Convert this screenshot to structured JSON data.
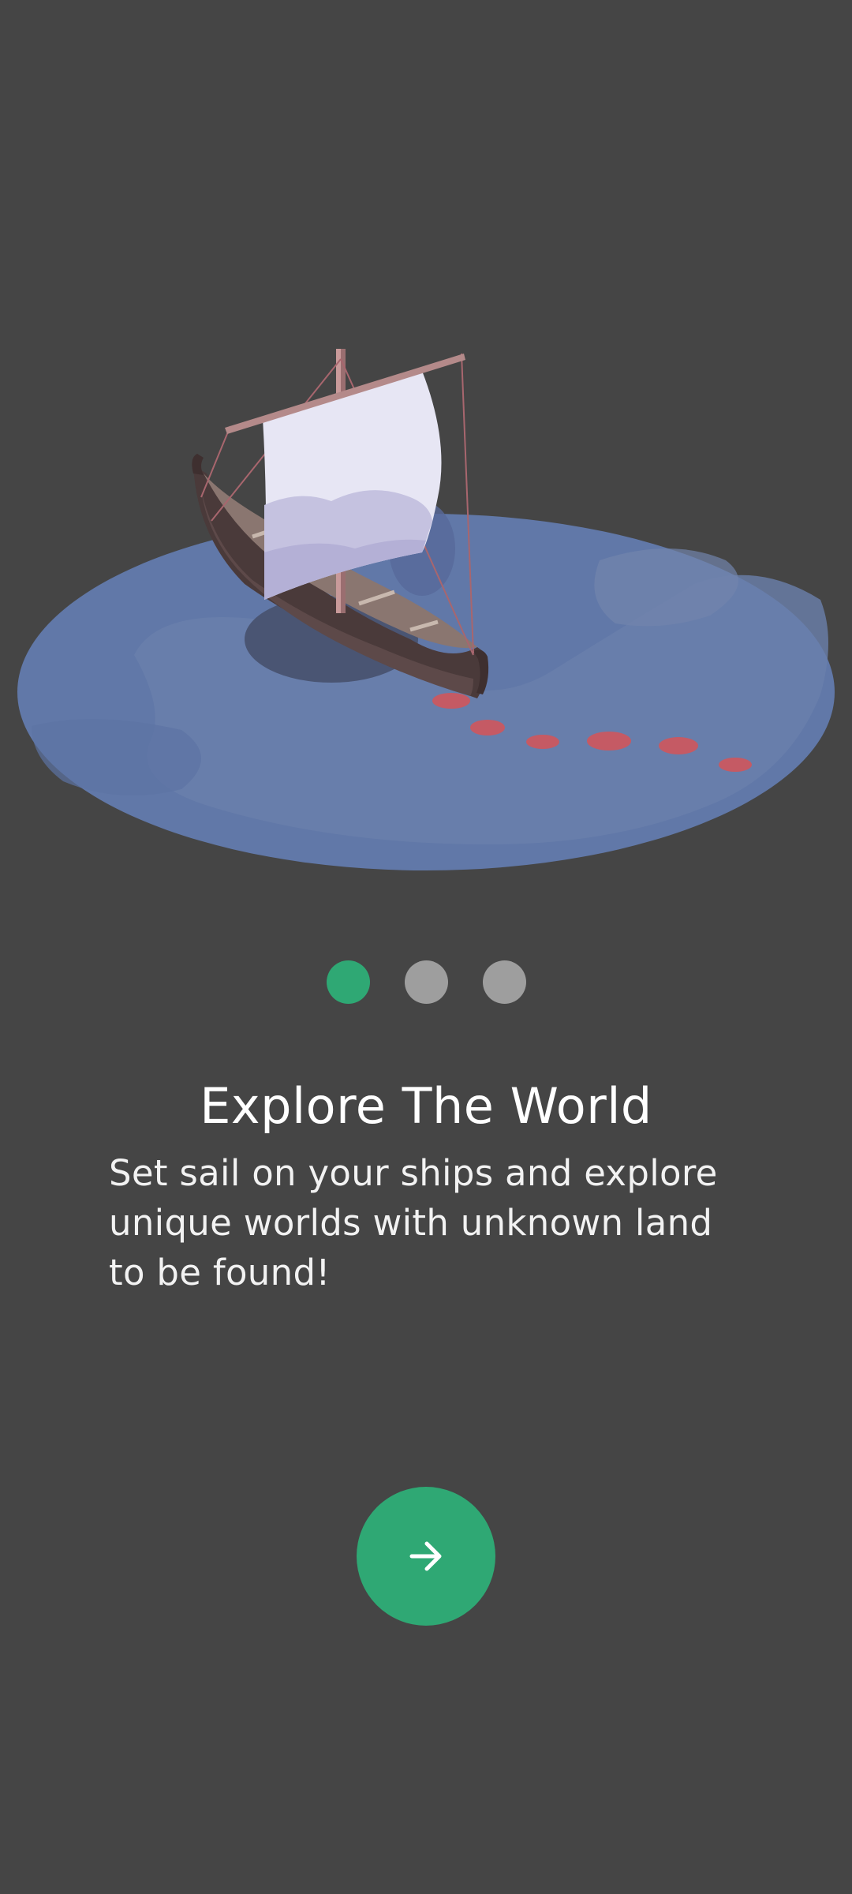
{
  "onboarding": {
    "title": "Explore The World",
    "description": "Set sail on your ships and explore unique worlds with unknown land to be found!",
    "pager": {
      "count": 3,
      "active_index": 0
    },
    "next_button": {
      "icon": "arrow-right-icon"
    }
  },
  "illustration": {
    "icon": "viking-ship-illustration"
  },
  "colors": {
    "background": "#454545",
    "accent": "#2fa874",
    "inactive_dot": "#9e9e9e",
    "water": "#6178a8",
    "trail": "#c55a64"
  }
}
